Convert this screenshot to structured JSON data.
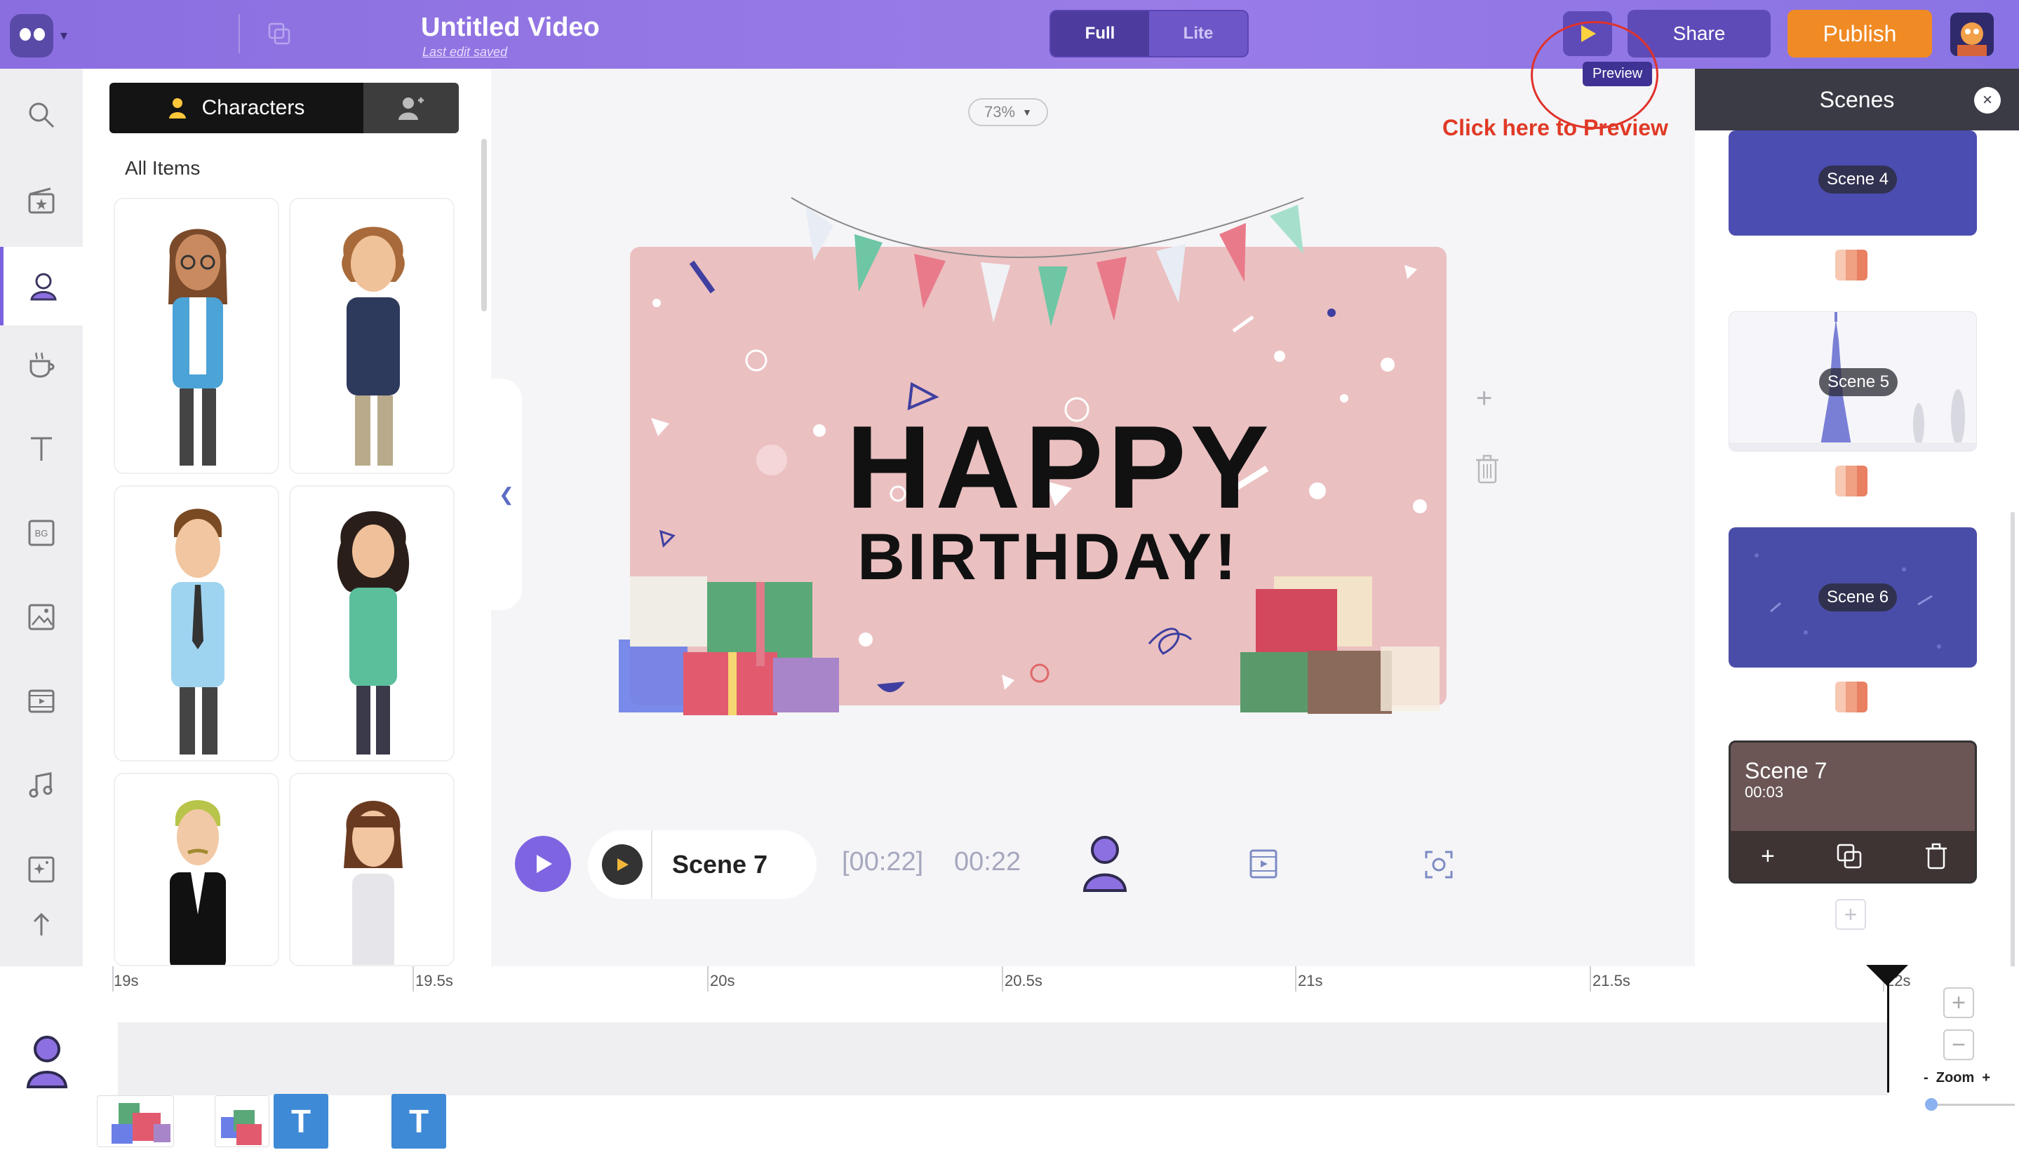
{
  "header": {
    "title": "Untitled Video",
    "last_edit": "Last edit saved",
    "mode_full": "Full",
    "mode_lite": "Lite",
    "preview_tooltip": "Preview",
    "share_label": "Share",
    "publish_label": "Publish",
    "accent_color": "#8a6ee0",
    "publish_color": "#f08a24"
  },
  "annotation": {
    "callout": "Click here to Preview",
    "color": "#e03a26"
  },
  "sidebar": {
    "items": [
      {
        "icon": "search-icon"
      },
      {
        "icon": "clapperboard-star-icon"
      },
      {
        "icon": "character-icon",
        "active": true
      },
      {
        "icon": "coffee-cup-icon"
      },
      {
        "icon": "text-icon"
      },
      {
        "icon": "background-icon",
        "label": "BG"
      },
      {
        "icon": "image-icon"
      },
      {
        "icon": "video-icon"
      },
      {
        "icon": "music-icon"
      },
      {
        "icon": "effects-icon"
      },
      {
        "icon": "upload-icon"
      }
    ]
  },
  "panel": {
    "tab_label": "Characters",
    "section_title": "All Items"
  },
  "canvas": {
    "zoom": "73%",
    "headline": "HAPPY",
    "subheadline": "BIRTHDAY!",
    "background_color": "#ebc0c1"
  },
  "player": {
    "scene_name": "Scene 7",
    "elapsed": "[00:22]",
    "total": "00:22"
  },
  "scenes": {
    "title": "Scenes",
    "items": [
      {
        "label": "Scene 4",
        "color": "#4b4db0"
      },
      {
        "label": "Scene 5",
        "color": "#f6f6fa"
      },
      {
        "label": "Scene 6",
        "color": "#4a4da8"
      },
      {
        "label": "Scene 7",
        "duration": "00:03",
        "color": "#6b5555",
        "selected": true
      }
    ]
  },
  "timeline": {
    "ticks": [
      "19s",
      "19.5s",
      "20s",
      "20.5s",
      "21s",
      "21.5s",
      "22s"
    ],
    "zoom_label": "Zoom",
    "zoom_minus": "-",
    "zoom_plus": "+",
    "text_clip_label": "T"
  }
}
